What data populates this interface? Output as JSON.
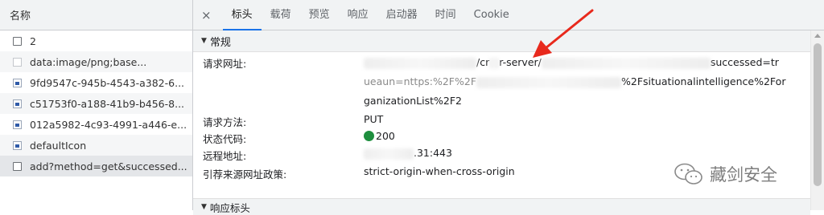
{
  "left": {
    "header": "名称",
    "requests": [
      {
        "label": "2",
        "icon": "document-icon"
      },
      {
        "label": "data:image/png;base...",
        "icon": "broken-image-icon"
      },
      {
        "label": "9fd9547c-945b-4543-a382-6...",
        "icon": "image-icon"
      },
      {
        "label": "c51753f0-a188-41b9-b456-8...",
        "icon": "image-icon"
      },
      {
        "label": "012a5982-4c93-4991-a446-e...",
        "icon": "image-icon"
      },
      {
        "label": "defaultIcon",
        "icon": "image-icon"
      },
      {
        "label": "add?method=get&successed...",
        "icon": "document-icon"
      }
    ]
  },
  "tabs": {
    "close": "×",
    "items": [
      "标头",
      "载荷",
      "预览",
      "响应",
      "启动器",
      "时间",
      "Cookie"
    ],
    "active": "标头"
  },
  "general": {
    "title": "常规",
    "url_label": "请求网址:",
    "url_line1_a": "/cr",
    "url_line1_b": "r-server/",
    "url_line1_c": "successed=tr",
    "url_line2_a": "ueaun=nttps:%2F%2F",
    "url_line2_b": "%2Fsituationalintelligence%2For",
    "url_line3": "ganizationList%2F2",
    "method_label": "请求方法:",
    "method_value": "PUT",
    "status_label": "状态代码:",
    "status_value": "200",
    "status_color": "#1e8e3e",
    "remote_label": "远程地址:",
    "remote_value": ".31:443",
    "referrer_label": "引荐来源网址政策:",
    "referrer_value": "strict-origin-when-cross-origin"
  },
  "response_headers": {
    "title": "响应标头"
  },
  "watermark": {
    "text": "藏剑安全"
  },
  "colors": {
    "accent": "#1a73e8",
    "arrow": "#e8291c"
  }
}
